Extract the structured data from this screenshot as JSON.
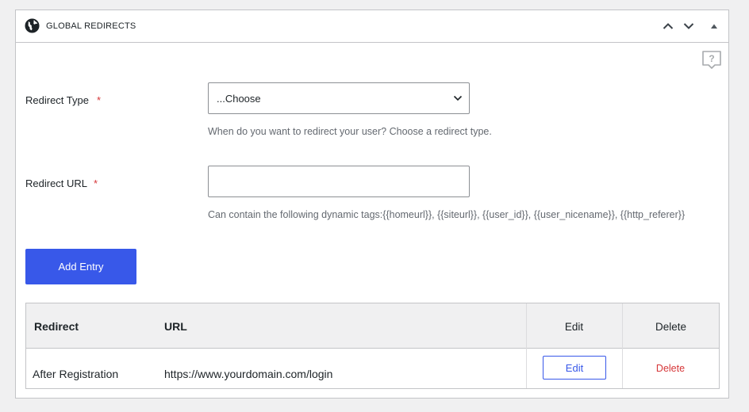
{
  "panel": {
    "title": "GLOBAL REDIRECTS",
    "icons": {
      "section": "globe-icon",
      "move_up": "chevron-up-icon",
      "move_down": "chevron-down-icon",
      "collapse": "triangle-up-icon",
      "help": "help-icon"
    }
  },
  "form": {
    "redirect_type": {
      "label": "Redirect Type",
      "required_mark": "*",
      "selected": "...Choose",
      "description": "When do you want to redirect your user? Choose a redirect type."
    },
    "redirect_url": {
      "label": "Redirect URL",
      "required_mark": "*",
      "value": "",
      "description": "Can contain the following dynamic tags:{{homeurl}}, {{siteurl}}, {{user_id}}, {{user_nicename}}, {{http_referer}}"
    },
    "add_button_label": "Add Entry"
  },
  "table": {
    "headers": {
      "redirect": "Redirect",
      "url": "URL",
      "edit": "Edit",
      "delete": "Delete"
    },
    "rows": [
      {
        "redirect": "After Registration",
        "url": "https://www.yourdomain.com/login",
        "edit_label": "Edit",
        "delete_label": "Delete"
      }
    ]
  },
  "colors": {
    "accent": "#3858e9",
    "danger": "#d63638",
    "border": "#c3c4c7",
    "header_bg": "#f0f0f1"
  }
}
